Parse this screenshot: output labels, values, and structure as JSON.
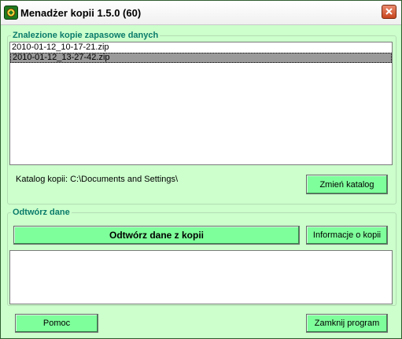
{
  "window": {
    "title": "Menadżer kopii  1.5.0 (60)"
  },
  "icons": {
    "app": "app-icon",
    "close": "close-icon"
  },
  "backups": {
    "legend": "Znalezione kopie zapasowe danych",
    "items": [
      {
        "label": "2010-01-12_10-17-21.zip",
        "selected": false
      },
      {
        "label": "2010-01-12_13-27-42.zip",
        "selected": true
      }
    ],
    "catalog_label": "Katalog kopii: C:\\Documents and Settings\\",
    "change_button": "Zmień katalog"
  },
  "restore": {
    "legend": "Odtwórz dane",
    "restore_button": "Odtwórz dane z kopii",
    "info_button": "Informacje o kopii",
    "output_text": ""
  },
  "footer": {
    "help_button": "Pomoc",
    "close_button": "Zamknij program"
  },
  "colors": {
    "background": "#ccffcc",
    "button": "#7fff9b",
    "legend_text": "#0a7a6a",
    "selection": "#9a9a9a"
  }
}
